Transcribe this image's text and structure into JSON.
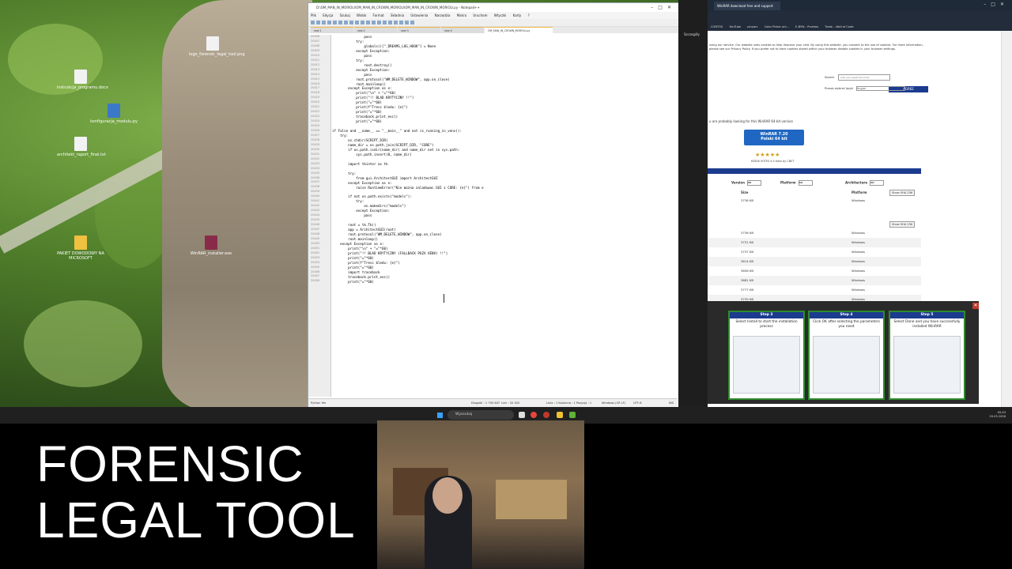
{
  "desktop": {
    "icons": [
      {
        "label": "logo_forensic_legal_tool.png"
      },
      {
        "label": "instrukcja_programu.docx"
      },
      {
        "label": "konfiguracja_modulu.py"
      },
      {
        "label": "architekt_raport_final.txt"
      },
      {
        "label": "PAKIET DOWODOWY NA MICROSOFT"
      },
      {
        "label": "WinRAR_installer.exe"
      }
    ]
  },
  "notepad": {
    "title": "D:\\OM_MAN_IN_MORIOLI\\OM_MAN_IN_CROWN_MORIOLI\\OM_MAN_IN_CROWN_MORIOLI.py - Notepad++",
    "menu": [
      "Plik",
      "Edycja",
      "Szukaj",
      "Widok",
      "Format",
      "Składnia",
      "Ustawienia",
      "Narzędzia",
      "Makra",
      "Uruchom",
      "Wtyczki",
      "Karty",
      "?"
    ],
    "tabs": [
      "new 1",
      "new 2",
      "new 3",
      "new 4",
      "OM_MAN_IN_CROWN_MORIOLI.py"
    ],
    "first_line_number": 20406,
    "code": [
      "                pass",
      "            try:",
      "                globals()[\"_DREAMS_LOG_HOOK\"] = None",
      "            except Exception:",
      "                pass",
      "            try:",
      "                root.destroy()",
      "            except Exception:",
      "                pass",
      "            root.protocol(\"WM_DELETE_WINDOW\", app.on_close)",
      "            root.mainloop()",
      "        except Exception as e:",
      "            print(\"\\n\" + \"=\"*60)",
      "            print(\"!! BLAD KRYTYCZNY !!\")",
      "            print(\"=\"*60)",
      "            print(f\"Tresc bledu: {e}\")",
      "            print(\"=\"*60)",
      "            traceback.print_exc()",
      "            print(\"=\"*60)",
      "",
      "if False and __name__ == \"__main__\" and not is_running_in_venv():",
      "    try:",
      "        os.chdir(SCRIPT_DIR)",
      "        name_dir = os.path.join(SCRIPT_DIR, \"CORE\")",
      "        if os.path.isdir(name_dir) and name_dir not in sys.path:",
      "            sys.path.insert(0, name_dir)",
      "",
      "        import tkinter as tk",
      "",
      "        try:",
      "            from gui.ArchitectGUI import ArchitectGUI",
      "        except Exception as e:",
      "            raise RuntimeError(\"Nie mozna zaladowac GUI z CORE: {e}\") from e",
      "",
      "        if not os.path.exists(\"models\"):",
      "            try:",
      "                os.makedirs(\"models\")",
      "            except Exception:",
      "                pass",
      "",
      "        root = tk.Tk()",
      "        app = ArchitectGUI(root)",
      "        root.protocol(\"WM_DELETE_WINDOW\", app.on_close)",
      "        root.mainloop()",
      "    except Exception as e:",
      "        print(\"\\n\" + \"=\"*60)",
      "        print(\"!! BLAD KRYTYCZNY (FALLBACK POZA VENV) !!\")",
      "        print(\"=\"*60)",
      "        print(f\"Tresc bledu: {e}\")",
      "        print(\"=\"*60)",
      "        import traceback",
      "        traceback.print_exc()",
      "        print(\"=\"*60)"
    ],
    "status": {
      "lang": "Python file",
      "length": "Długość : 1 700 647",
      "lines": "Linii : 20 452",
      "pos": "Linia : 1    Kolumna : 1    Pozycja : 1",
      "eol": "Windows (CR LF)",
      "enc": "UTF-8",
      "ins": "INS"
    }
  },
  "dark_strip": {
    "label": "Szczegóły"
  },
  "browser": {
    "tab_title": "WinRAR download free and support",
    "bookmarks": [
      "CONTOS",
      "YouTube",
      "pinyarc",
      "Color Picker onl...",
      "E-BYW - Przelew",
      "Trade – Wall of Code"
    ],
    "cookie_text": "using our service. Our website uses cookies to help improve your visit. By using this website, you consent to the use of cookies. For more information, please see our Privacy Policy. If you prefer not to have cookies stored within your browser disable cookies in your browser settings.",
    "agree_label": "AGREE",
    "search_label": "Search",
    "search_placeholder": "enter your search term here",
    "language_label": "Proszę wybrać język",
    "language_value": "English",
    "lead_text": "u are probably looking for this WinRAR 64-bit version",
    "download_line1": "WinRAR 7.20",
    "download_line2": "Polski 64 bit",
    "stars": "★★★★★",
    "votes": "63826 VOTES 4.5 stars by CNET",
    "filters": {
      "version": "Version",
      "platform": "Platform",
      "architecture": "Architecture",
      "all": "All"
    },
    "headers": {
      "size": "Size",
      "platform": "Platform"
    },
    "sha_label": "Show SHA 256",
    "rows": [
      {
        "size": "3736 KB",
        "platform": "Windows"
      },
      {
        "size": "3736 KB",
        "platform": "Windows"
      },
      {
        "size": "3731 KB",
        "platform": "Windows"
      },
      {
        "size": "3737 KB",
        "platform": "Windows"
      },
      {
        "size": "3614 KB",
        "platform": "Windows"
      },
      {
        "size": "3658 KB",
        "platform": "Windows"
      },
      {
        "size": "3681 KB",
        "platform": "Windows"
      },
      {
        "size": "3777 KB",
        "platform": "Windows"
      },
      {
        "size": "3739 KB",
        "platform": "Windows"
      }
    ]
  },
  "steps": [
    {
      "title": "Step 3",
      "text": "Select Install to start the installation process"
    },
    {
      "title": "Step 4",
      "text": "Click OK after selecting the parameters you need"
    },
    {
      "title": "Step 5",
      "text": "Select Done and you have successfully installed WinRAR"
    }
  ],
  "taskbar": {
    "search_placeholder": "Wyszukaj",
    "time": "05:43",
    "date": "20.03.2026"
  },
  "overlay": {
    "line1": "FORENSIC",
    "line2": "LEGAL TOOL"
  }
}
